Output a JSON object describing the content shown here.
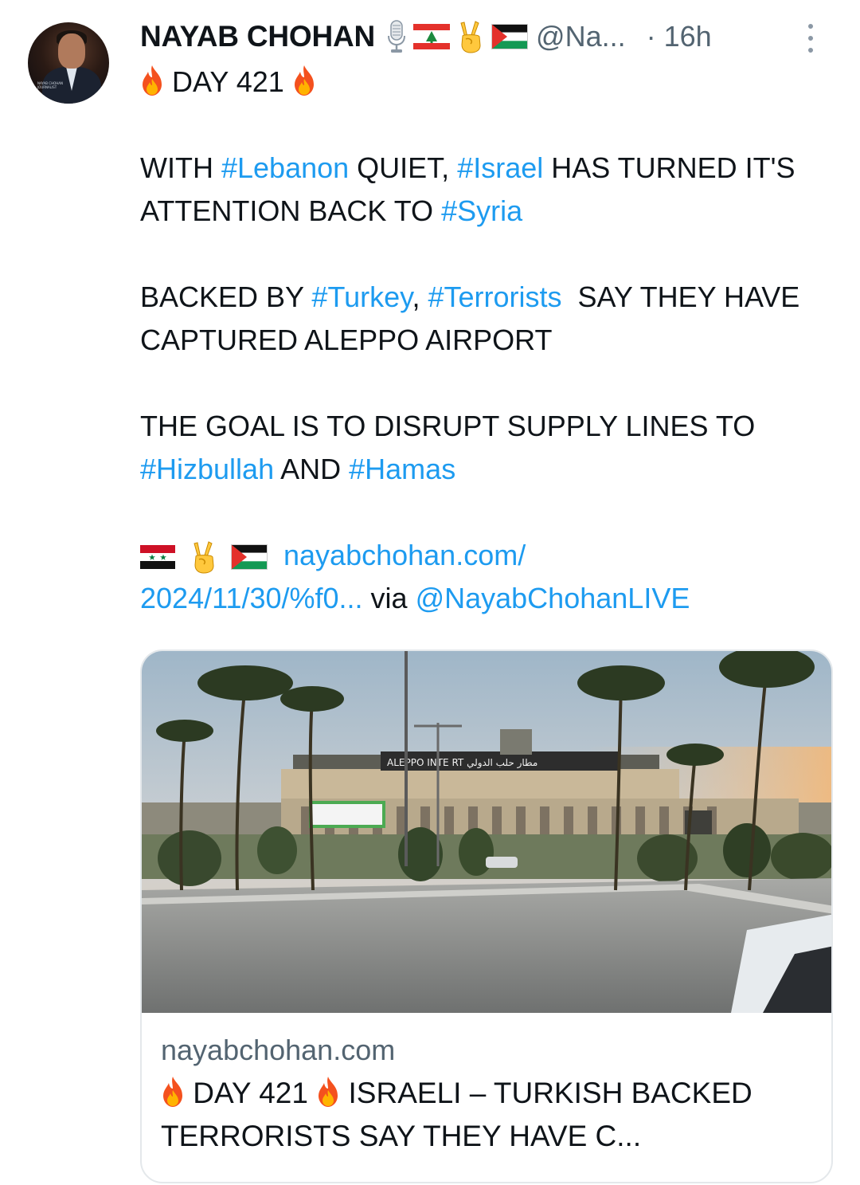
{
  "tweet": {
    "author": {
      "name": "NAYAB CHOHAN",
      "handle": "@Na...",
      "time": "· 16h",
      "avatar_caption": [
        "NAYAB CHOHAN",
        "JOURNALIST"
      ]
    },
    "name_badges": [
      "microphone-icon",
      "flag-lebanon-icon",
      "victory-hand-icon",
      "flag-palestine-icon"
    ],
    "body": {
      "day_line": "DAY 421",
      "p1_a": "WITH ",
      "p1_tag1": "#Lebanon",
      "p1_b": " QUIET, ",
      "p1_tag2": "#Israel",
      "p1_c": " HAS TURNED IT'S ATTENTION BACK TO ",
      "p1_tag3": "#Syria",
      "p2_a": "BACKED BY ",
      "p2_tag1": "#Turkey",
      "p2_b": ", ",
      "p2_tag2": "#Terrorists",
      "p2_c": "  SAY THEY HAVE CAPTURED ALEPPO AIRPORT",
      "p3_a": "THE GOAL IS TO DISRUPT SUPPLY LINES TO ",
      "p3_tag1": "#Hizbullah",
      "p3_b": " AND ",
      "p3_tag2": "#Hamas",
      "link_text": "nayabchohan.com/",
      "link_text2": "2024/11/30/%f0...",
      "via": " via ",
      "via_handle": "@NayabChohanLIVE"
    },
    "link_card": {
      "domain": "nayabchohan.com",
      "title_day": "DAY 421",
      "title_rest": "ISRAELI – TURKISH BACKED TERRORISTS SAY THEY HAVE C...",
      "image_sign_text": "ALEPPO INTE   RT  مطار حلب الدولي"
    }
  },
  "colors": {
    "text": "#0f1419",
    "muted": "#536471",
    "link": "#1d9bf0",
    "border": "#e4e8eb"
  }
}
